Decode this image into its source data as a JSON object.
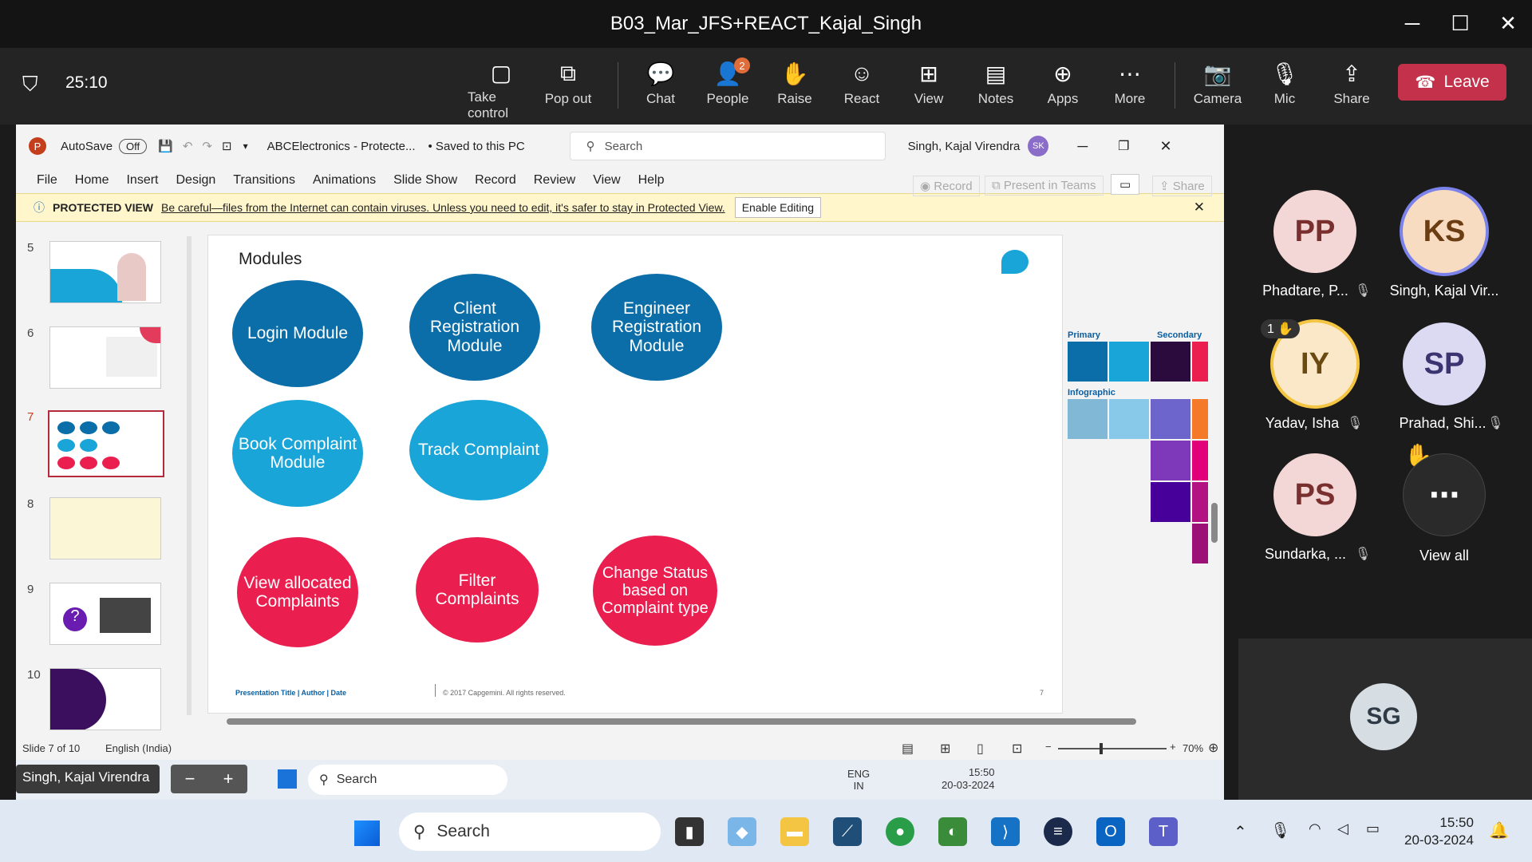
{
  "teams": {
    "title": "B03_Mar_JFS+REACT_Kajal_Singh",
    "timer": "25:10",
    "buttons": [
      {
        "label": "Take control",
        "icon": "take-control-icon",
        "glyph": "▢"
      },
      {
        "label": "Pop out",
        "icon": "pop-out-icon",
        "glyph": "⧉"
      },
      {
        "label": "Chat",
        "icon": "chat-icon",
        "glyph": "💬"
      },
      {
        "label": "People",
        "icon": "people-icon",
        "glyph": "👤",
        "badge": "2"
      },
      {
        "label": "Raise",
        "icon": "raise-hand-icon",
        "glyph": "✋"
      },
      {
        "label": "React",
        "icon": "react-icon",
        "glyph": "☺"
      },
      {
        "label": "View",
        "icon": "view-icon",
        "glyph": "⊞"
      },
      {
        "label": "Notes",
        "icon": "notes-icon",
        "glyph": "▤"
      },
      {
        "label": "Apps",
        "icon": "apps-icon",
        "glyph": "⊕"
      },
      {
        "label": "More",
        "icon": "more-icon",
        "glyph": "⋯"
      },
      {
        "label": "Camera",
        "icon": "camera-off-icon",
        "glyph": "📷"
      },
      {
        "label": "Mic",
        "icon": "mic-off-icon",
        "glyph": "🎙"
      },
      {
        "label": "Share",
        "icon": "share-icon",
        "glyph": "⇪"
      }
    ],
    "leave": "Leave"
  },
  "ppt": {
    "autosave": "AutoSave",
    "toggle": "Off",
    "filename": "ABCElectronics - Protecte...",
    "saved": "• Saved to this PC",
    "search_placeholder": "Search",
    "user": "Singh, Kajal Virendra",
    "user_initials": "SK",
    "menu": [
      "File",
      "Home",
      "Insert",
      "Design",
      "Transitions",
      "Animations",
      "Slide Show",
      "Record",
      "Review",
      "View",
      "Help"
    ],
    "record": "Record",
    "present": "Present in Teams",
    "share": "Share",
    "protected_label": "PROTECTED VIEW",
    "protected_msg": "Be careful—files from the Internet can contain viruses. Unless you need to edit, it's safer to stay in Protected View.",
    "enable_editing": "Enable Editing",
    "thumb_numbers": [
      "5",
      "6",
      "7",
      "8",
      "9",
      "10"
    ],
    "slide": {
      "title": "Modules",
      "footer_left": "Presentation Title | Author | Date",
      "footer_copy": "© 2017 Capgemini. All rights reserved.",
      "page": "7",
      "modules": [
        "Login Module",
        "Client Registration Module",
        "Engineer Registration Module",
        "Book Complaint Module",
        "Track Complaint",
        "View allocated Complaints",
        "Filter Complaints",
        "Change Status based on Complaint type"
      ]
    },
    "palette": {
      "primary": "Primary",
      "secondary": "Secondary",
      "infographic": "Infographic"
    },
    "status": {
      "slide": "Slide 7 of 10",
      "language": "English (India)",
      "zoom": "70%"
    },
    "inner_taskbar": {
      "user": "Singh, Kajal Virendra",
      "search": "Search",
      "lang1": "ENG",
      "lang2": "IN",
      "time": "15:50",
      "date": "20-03-2024"
    }
  },
  "participants": [
    {
      "initials": "PP",
      "name": "Phadtare, P..."
    },
    {
      "initials": "KS",
      "name": "Singh, Kajal Vir..."
    },
    {
      "initials": "IY",
      "name": "Yadav, Isha",
      "hand": "1"
    },
    {
      "initials": "SP",
      "name": "Prahad, Shi..."
    },
    {
      "initials": "PS",
      "name": "Sundarka, ..."
    },
    {
      "initials": "⋯",
      "name": "View all"
    },
    {
      "initials": "SG",
      "name": ""
    }
  ],
  "taskbar": {
    "search": "Search",
    "time": "15:50",
    "date": "20-03-2024"
  }
}
